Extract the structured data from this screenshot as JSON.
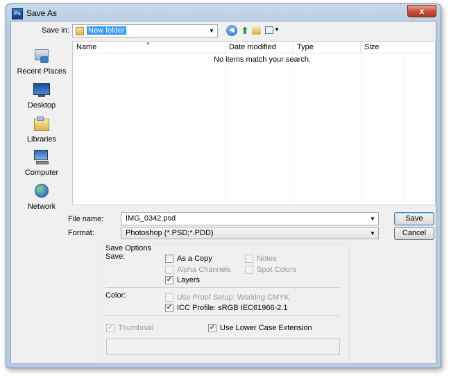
{
  "window": {
    "title": "Save As",
    "app_icon_text": "Ps",
    "close_glyph": "x"
  },
  "toolbar": {
    "save_in_label": "Save in:",
    "save_in_value": "New folder"
  },
  "places": [
    {
      "label": "Recent Places",
      "icon": "recent-places-icon"
    },
    {
      "label": "Desktop",
      "icon": "desktop-icon"
    },
    {
      "label": "Libraries",
      "icon": "libraries-icon"
    },
    {
      "label": "Computer",
      "icon": "computer-icon"
    },
    {
      "label": "Network",
      "icon": "network-icon"
    }
  ],
  "file_list": {
    "columns": [
      "Name",
      "Date modified",
      "Type",
      "Size"
    ],
    "empty_message": "No items match your search."
  },
  "file_name": {
    "label": "File name:",
    "value": "IMG_0342.psd"
  },
  "format": {
    "label": "Format:",
    "value": "Photoshop (*.PSD;*.PDD)"
  },
  "buttons": {
    "save": "Save",
    "cancel": "Cancel"
  },
  "save_options": {
    "title": "Save Options",
    "save_label": "Save:",
    "as_a_copy": {
      "label": "As a Copy",
      "checked": false,
      "enabled": true
    },
    "notes": {
      "label": "Notes",
      "checked": false,
      "enabled": false
    },
    "alpha_channels": {
      "label": "Alpha Channels",
      "checked": false,
      "enabled": false
    },
    "spot_colors": {
      "label": "Spot Colors",
      "checked": false,
      "enabled": false
    },
    "layers": {
      "label": "Layers",
      "checked": true,
      "enabled": true
    },
    "color_label": "Color:",
    "use_proof_setup": {
      "label": "Use Proof Setup:  Working CMYK",
      "checked": false,
      "enabled": false
    },
    "icc_profile": {
      "label": "ICC Profile:  sRGB IEC61966-2.1",
      "checked": true,
      "enabled": true
    },
    "thumbnail": {
      "label": "Thumbnail",
      "checked": true,
      "enabled": false
    },
    "lower_case_ext": {
      "label": "Use Lower Case Extension",
      "checked": true,
      "enabled": true
    }
  },
  "colors": {
    "selection": "#3399ff",
    "titlebar": "#b7cce2",
    "close_button": "#c7503a"
  }
}
